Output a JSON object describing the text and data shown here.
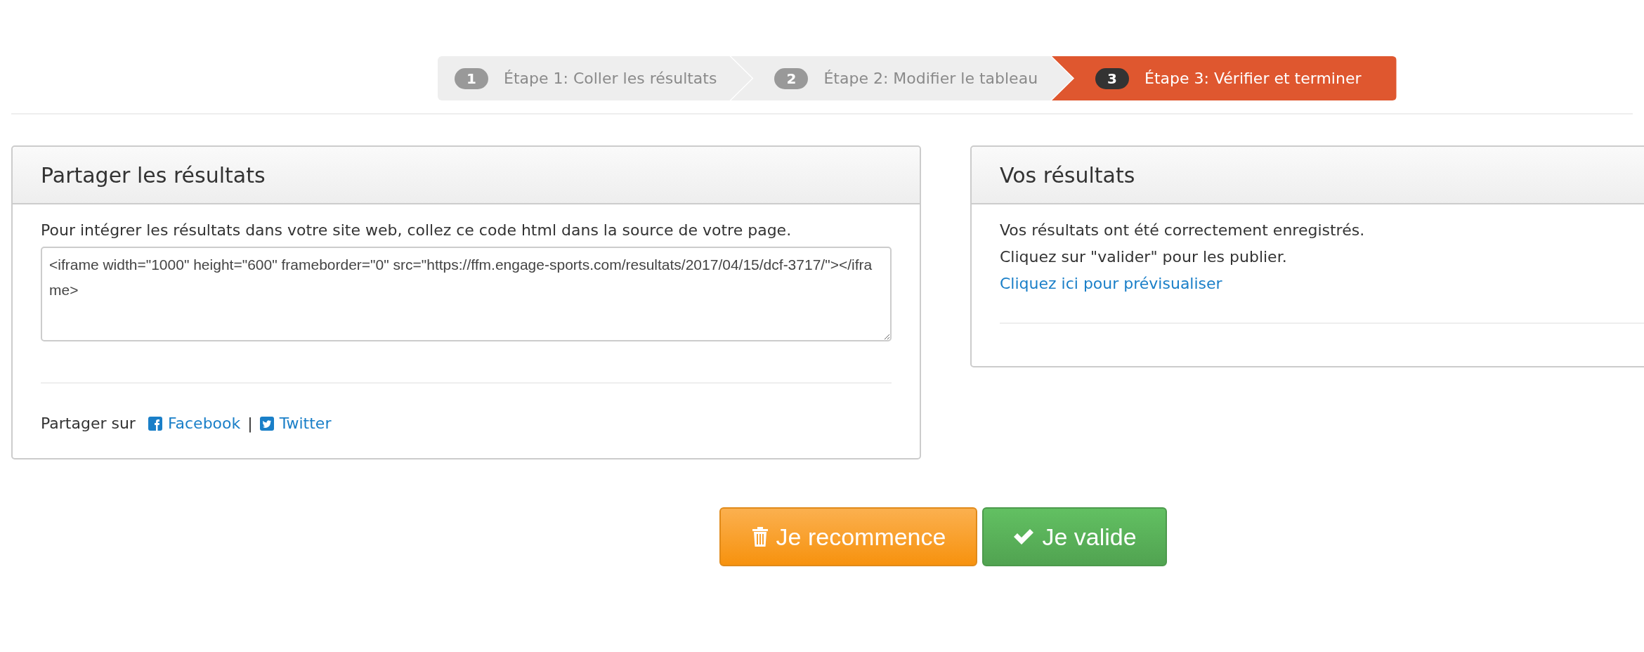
{
  "steps": [
    {
      "number": "1",
      "label": "Étape 1: Coller les résultats",
      "selected": false
    },
    {
      "number": "2",
      "label": "Étape 2: Modifier le tableau",
      "selected": false
    },
    {
      "number": "3",
      "label": "Étape 3: Vérifier et terminer",
      "selected": true
    }
  ],
  "share_panel": {
    "title": "Partager les résultats",
    "instructions": "Pour intégrer les résultats dans votre site web, collez ce code html dans la source de votre page.",
    "embed_code": "<iframe width=\"1000\" height=\"600\" frameborder=\"0\" src=\"https://ffm.engage-sports.com/resultats/2017/04/15/dcf-3717/\"></iframe>",
    "share_label": "Partager sur",
    "links": [
      {
        "kind": "facebook",
        "label": "Facebook"
      },
      {
        "kind": "twitter",
        "label": "Twitter"
      }
    ],
    "separator": "|"
  },
  "results_panel": {
    "title": "Vos résultats",
    "lines": [
      "Vos résultats ont été correctement enregistrés.",
      "Cliquez sur \"valider\" pour les publier."
    ],
    "preview_link": "Cliquez ici pour prévisualiser"
  },
  "buttons": [
    {
      "kind": "restart",
      "label": "Je recommence"
    },
    {
      "kind": "validate",
      "label": "Je valide"
    }
  ]
}
